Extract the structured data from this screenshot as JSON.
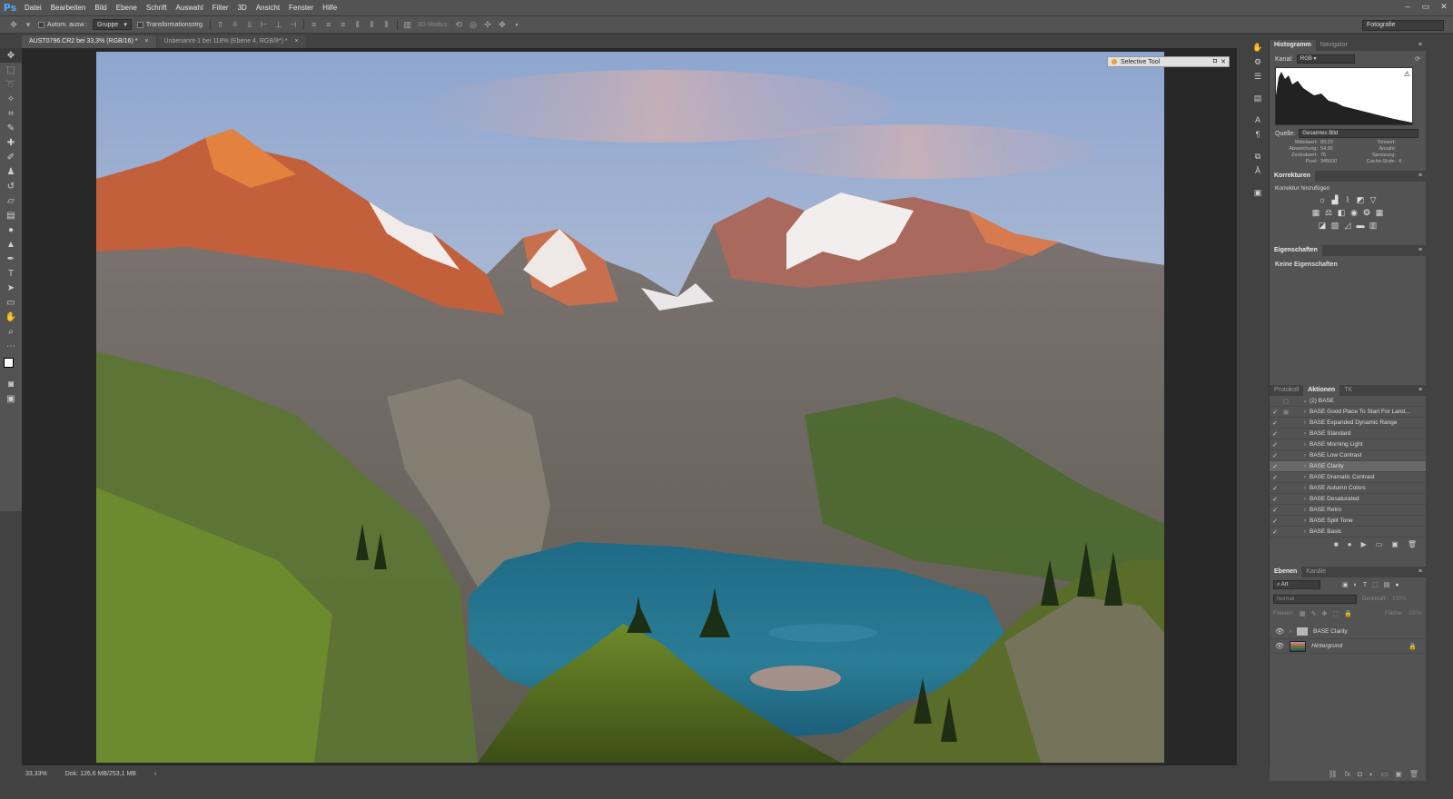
{
  "app": {
    "logo": "Ps"
  },
  "menu": [
    {
      "label": "Datei"
    },
    {
      "label": "Bearbeiten"
    },
    {
      "label": "Bild"
    },
    {
      "label": "Ebene"
    },
    {
      "label": "Schrift"
    },
    {
      "label": "Auswahl"
    },
    {
      "label": "Filter"
    },
    {
      "label": "3D"
    },
    {
      "label": "Ansicht"
    },
    {
      "label": "Fenster"
    },
    {
      "label": "Hilfe"
    }
  ],
  "window_controls": {
    "minimize": "–",
    "restore": "▭",
    "close": "✕"
  },
  "options": {
    "auto_select_label": "Autom. ausw.:",
    "group_value": "Gruppe",
    "transform_label": "Transformationsstrg.",
    "mode3d_label": "3D-Modus:",
    "workspace": "Fotografie"
  },
  "tabs": [
    {
      "label": "AUST0796.CR2 bei 33,3% (RGB/16) *",
      "close": "×"
    },
    {
      "label": "Unbenannt-1 bei 118% (Ebene 4, RGB/8*) *",
      "close": "×"
    }
  ],
  "floating_panel": {
    "title": "Selective Tool",
    "ctl1": "◘",
    "ctl2": "✕"
  },
  "status": {
    "zoom": "33,33%",
    "doc": "Dok: 126,6 MB/253,1 MB",
    "arrow": "›"
  },
  "histogram": {
    "tab1": "Histogramm",
    "tab2": "Navigator",
    "menu": "≡",
    "channel_label": "Kanal:",
    "channel": "RGB",
    "source_label": "Quelle:",
    "source": "Gesamtes Bild",
    "stats": [
      {
        "k": "Mittelwert:",
        "v": "89,23",
        "k2": "Tonwert:",
        "v2": ""
      },
      {
        "k": "Abweichung:",
        "v": "54,96",
        "k2": "Anzahl:",
        "v2": ""
      },
      {
        "k": "Zentralwert:",
        "v": "76",
        "k2": "Spreizung:",
        "v2": ""
      },
      {
        "k": "Pixel:",
        "v": "345600",
        "k2": "Cache-Stufe:",
        "v2": "4"
      }
    ]
  },
  "corrections": {
    "title": "Korrekturen",
    "subtitle": "Korrektur hinzufügen",
    "menu": "≡"
  },
  "properties": {
    "title": "Eigenschaften",
    "content": "Keine Eigenschaften",
    "menu": "≡"
  },
  "actions": {
    "tabs": [
      "Protokoll",
      "Aktionen",
      "TK"
    ],
    "menu": "≡",
    "set_name": "(2) BASE",
    "items": [
      "BASE Good Place To Start For Land...",
      "BASE Expanded Dynamic Range",
      "BASE Standard",
      "BASE Morning Light",
      "BASE Low Contrast",
      "BASE Clarity",
      "BASE Dramatic Contrast",
      "BASE Autumn Colors",
      "BASE Desaturated",
      "BASE Retro",
      "BASE Split Tone",
      "BASE Basic"
    ],
    "selected_index": 5
  },
  "layers": {
    "tabs": [
      "Ebenen",
      "Kanäle"
    ],
    "menu": "≡",
    "filter": "Art",
    "blend": "Normal",
    "opacity_label": "Deckkraft:",
    "opacity": "100%",
    "lock_label": "Fixieren:",
    "fill_label": "Fläche:",
    "fill": "100%",
    "items": [
      {
        "name": "BASE Clarity",
        "kind": "group"
      },
      {
        "name": "Hintergrund",
        "kind": "image"
      }
    ]
  }
}
